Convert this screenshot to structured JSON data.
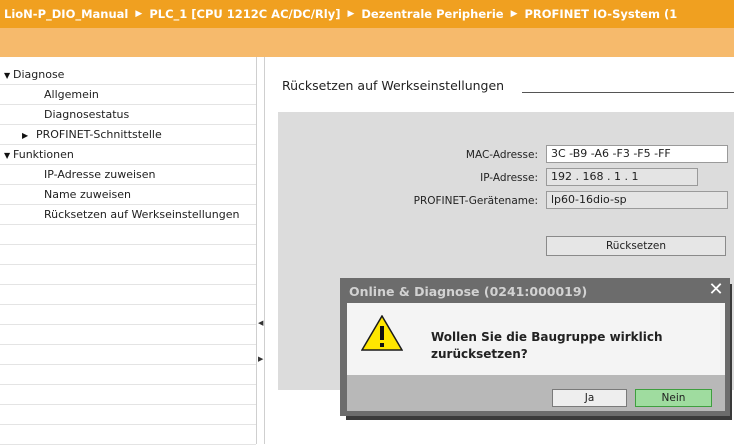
{
  "breadcrumb": [
    "LioN-P_DIO_Manual",
    "PLC_1 [CPU 1212C AC/DC/Rly]",
    "Dezentrale Peripherie",
    "PROFINET IO-System (1"
  ],
  "breadcrumb_separator": "▶",
  "tree": [
    {
      "label": "Diagnose",
      "toggle": "▼"
    },
    {
      "label": "Allgemein",
      "toggle": ""
    },
    {
      "label": "Diagnosestatus",
      "toggle": ""
    },
    {
      "label": "PROFINET-Schnittstelle",
      "toggle": "▶"
    },
    {
      "label": "Funktionen",
      "toggle": "▼"
    },
    {
      "label": "IP-Adresse zuweisen",
      "toggle": ""
    },
    {
      "label": "Name zuweisen",
      "toggle": ""
    },
    {
      "label": "Rücksetzen auf Werkseinstellungen",
      "toggle": ""
    }
  ],
  "splitter": {
    "collapse_left": "◀",
    "expand_right": "▶"
  },
  "section": {
    "title": "Rücksetzen auf Werkseinstellungen"
  },
  "form": {
    "mac_label": "MAC-Adresse:",
    "mac_value": "3C -B9 -A6 -F3 -F5 -FF",
    "ip_label": "IP-Adresse:",
    "ip_value": "192 . 168 . 1    . 1",
    "name_label": "PROFINET-Gerätename:",
    "name_value": "lp60-16dio-sp",
    "reset_button": "Rücksetzen"
  },
  "dialog": {
    "title": "Online & Diagnose (0241:000019)",
    "close": "✕",
    "message": "Wollen Sie die Baugruppe wirklich zurücksetzen?",
    "yes_button": "Ja",
    "no_button": "Nein"
  },
  "colors": {
    "accent": "#f0a020",
    "warning": "#ffe600",
    "confirm_green": "#9fdc9f"
  },
  "icons": {
    "warning": "warning-icon",
    "close": "close-icon"
  }
}
